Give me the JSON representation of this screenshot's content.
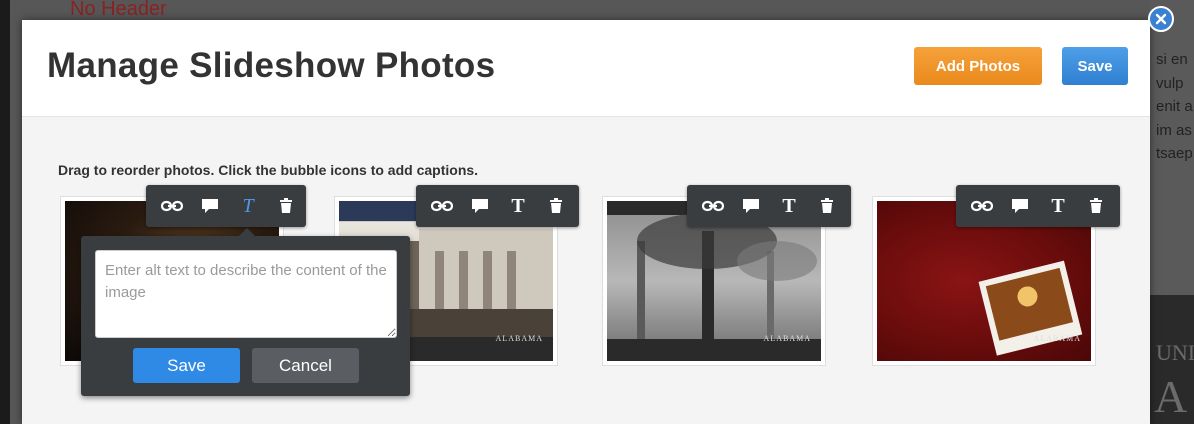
{
  "background": {
    "header_text": "No Header",
    "right_snippets": [
      "si en",
      "vulp",
      "enit a",
      "im as",
      "tsaep"
    ],
    "right_big_text": "UNI",
    "right_big_letter": "A"
  },
  "modal": {
    "title": "Manage Slideshow Photos",
    "add_photos_label": "Add Photos",
    "save_label": "Save",
    "instructions": "Drag to reorder photos. Click the bubble icons to add captions."
  },
  "photos": [
    {
      "logo_text": "",
      "active_tool": "text"
    },
    {
      "logo_text": "ALABAMA"
    },
    {
      "logo_text": "ALABAMA"
    },
    {
      "logo_text": "ALABAMA"
    }
  ],
  "toolbar_icons": [
    "link-icon",
    "caption-bubble-icon",
    "text-icon",
    "trash-icon"
  ],
  "toolbar_glyph": "T",
  "caption_popover": {
    "placeholder": "Enter alt text to describe the content of the image",
    "save_label": "Save",
    "cancel_label": "Cancel"
  },
  "colors": {
    "add_photos": "#ee921f",
    "save": "#3a8ad8",
    "popover_save": "#2f8ae6",
    "toolbar_bg": "#3a3d40",
    "active_tool": "#4a9be6"
  }
}
